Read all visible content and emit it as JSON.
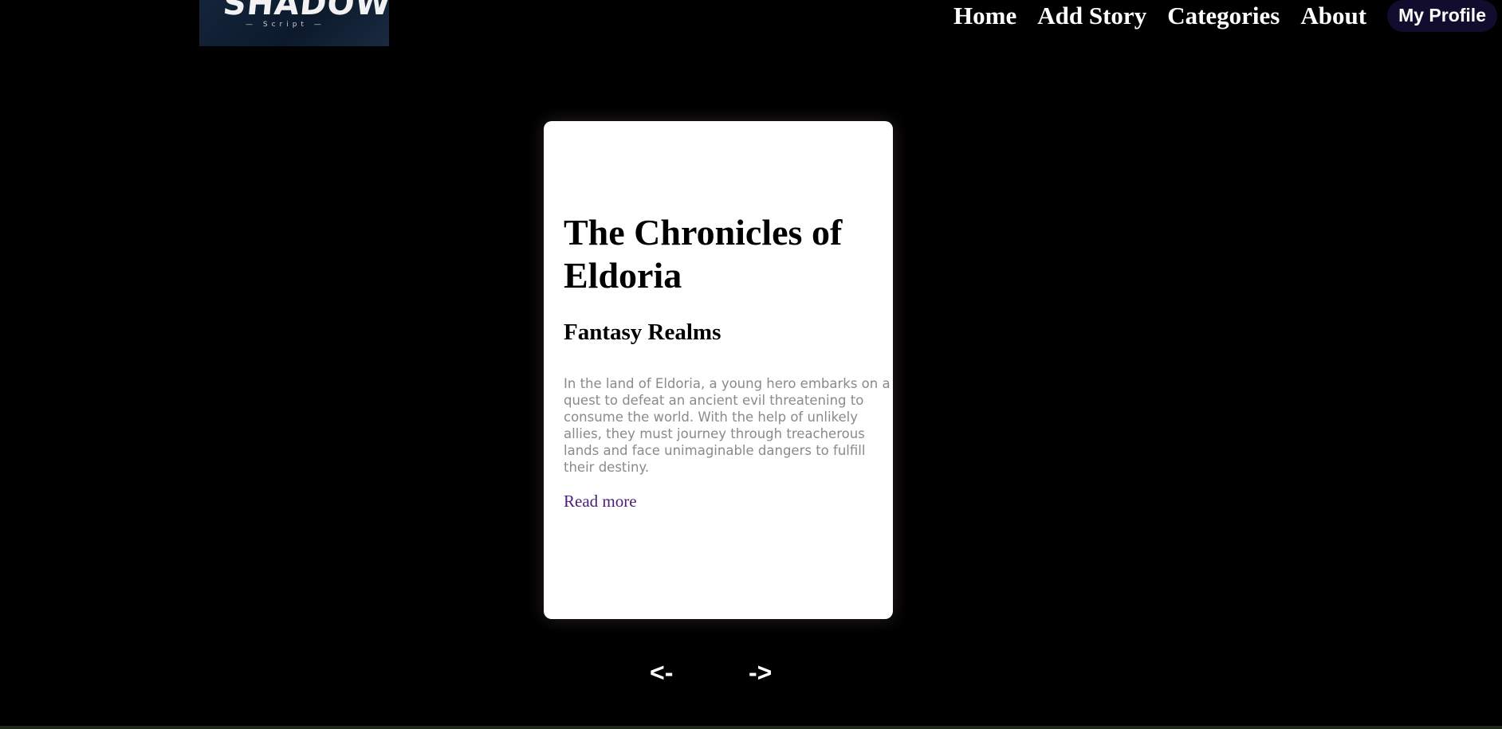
{
  "header": {
    "logo": {
      "text": "SHADOW",
      "subtext": "— Script —"
    },
    "nav": {
      "home": "Home",
      "add_story": "Add Story",
      "categories": "Categories",
      "about": "About",
      "profile": "My Profile"
    }
  },
  "story_card": {
    "title": "The Chronicles of Eldoria",
    "category": "Fantasy Realms",
    "description": "In the land of Eldoria, a young hero embarks on a quest to defeat an ancient evil threatening to consume the world. With the help of unlikely allies, they must journey through treacherous lands and face unimaginable dangers to fulfill their destiny.",
    "read_more": "Read more"
  },
  "carousel": {
    "prev_label": "<-",
    "next_label": "->"
  },
  "colors": {
    "background": "#000000",
    "card": "#ffffff",
    "link": "#4b1d7a",
    "profile_button": "#120c2e"
  }
}
